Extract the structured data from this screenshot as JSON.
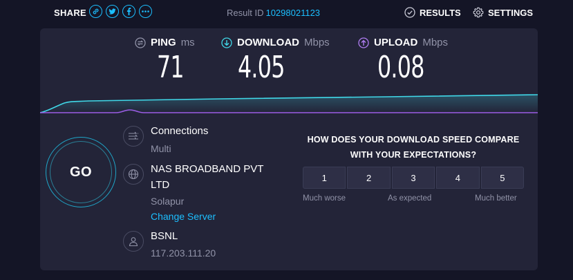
{
  "header": {
    "share_label": "SHARE",
    "share_icons": [
      "link-icon",
      "twitter-icon",
      "facebook-icon",
      "more-icon"
    ],
    "result_id_label": "Result ID",
    "result_id_value": "10298021123",
    "results_label": "RESULTS",
    "settings_label": "SETTINGS"
  },
  "metrics": {
    "ping": {
      "label": "PING",
      "unit": "ms",
      "value": "71"
    },
    "download": {
      "label": "DOWNLOAD",
      "unit": "Mbps",
      "value": "4.05"
    },
    "upload": {
      "label": "UPLOAD",
      "unit": "Mbps",
      "value": "0.08"
    }
  },
  "go_button": {
    "label": "GO"
  },
  "connection": {
    "title": "Connections",
    "mode": "Multi"
  },
  "server": {
    "name_line1": "NAS BROADBAND PVT",
    "name_line2": "LTD",
    "location": "Solapur",
    "change_label": "Change Server"
  },
  "isp": {
    "name": "BSNL",
    "ip": "117.203.111.20"
  },
  "feedback": {
    "question_line1": "HOW DOES YOUR DOWNLOAD SPEED COMPARE",
    "question_line2": "WITH YOUR EXPECTATIONS?",
    "options": [
      "1",
      "2",
      "3",
      "4",
      "5"
    ],
    "low_label": "Much worse",
    "mid_label": "As expected",
    "high_label": "Much better"
  },
  "colors": {
    "background": "#141526",
    "card": "#232438",
    "accent": "#1cbfff",
    "download_line": "#40d8e8",
    "upload_line": "#9b5de5",
    "muted_text": "#9193a8"
  }
}
